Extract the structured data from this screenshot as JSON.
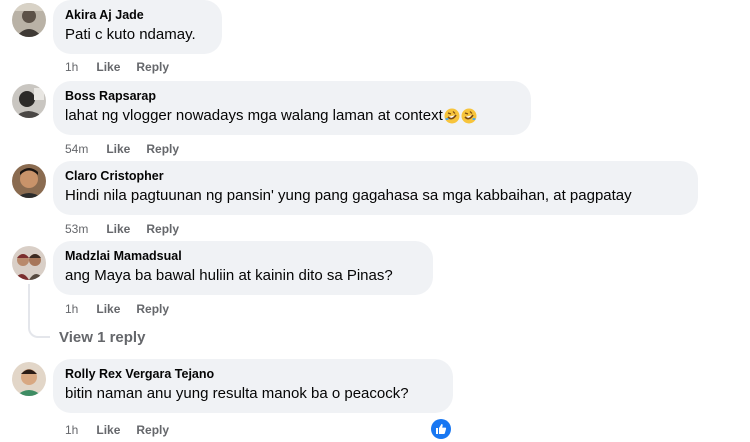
{
  "comments": [
    {
      "author": "Akira Aj Jade",
      "text": "Pati c kuto ndamay.",
      "time": "1h",
      "like_label": "Like",
      "reply_label": "Reply"
    },
    {
      "author": "Boss Rapsarap",
      "text": "lahat ng vlogger nowadays mga walang laman at context",
      "emojis": [
        "rolling-on-floor-laughing-emoji",
        "rolling-on-floor-laughing-emoji"
      ],
      "time": "54m",
      "like_label": "Like",
      "reply_label": "Reply"
    },
    {
      "author": "Claro Cristopher",
      "text": "Hindi nila pagtuunan ng pansin' yung pang gagahasa sa mga kabbaihan, at pagpatay",
      "time": "53m",
      "like_label": "Like",
      "reply_label": "Reply"
    },
    {
      "author": "Madzlai Mamadsual",
      "text": "ang Maya ba bawal huliin at kainin dito sa Pinas?",
      "time": "1h",
      "like_label": "Like",
      "reply_label": "Reply",
      "view_replies": "View 1 reply"
    },
    {
      "author": "Rolly Rex Vergara Tejano",
      "text": "bitin naman anu yung resulta manok ba o peacock?",
      "time": "1h",
      "like_label": "Like",
      "reply_label": "Reply",
      "reaction": "like-reaction-icon"
    }
  ],
  "colors": {
    "bubble": "#f0f2f5",
    "meta_text": "#65676b",
    "like_blue": "#1877f2"
  }
}
